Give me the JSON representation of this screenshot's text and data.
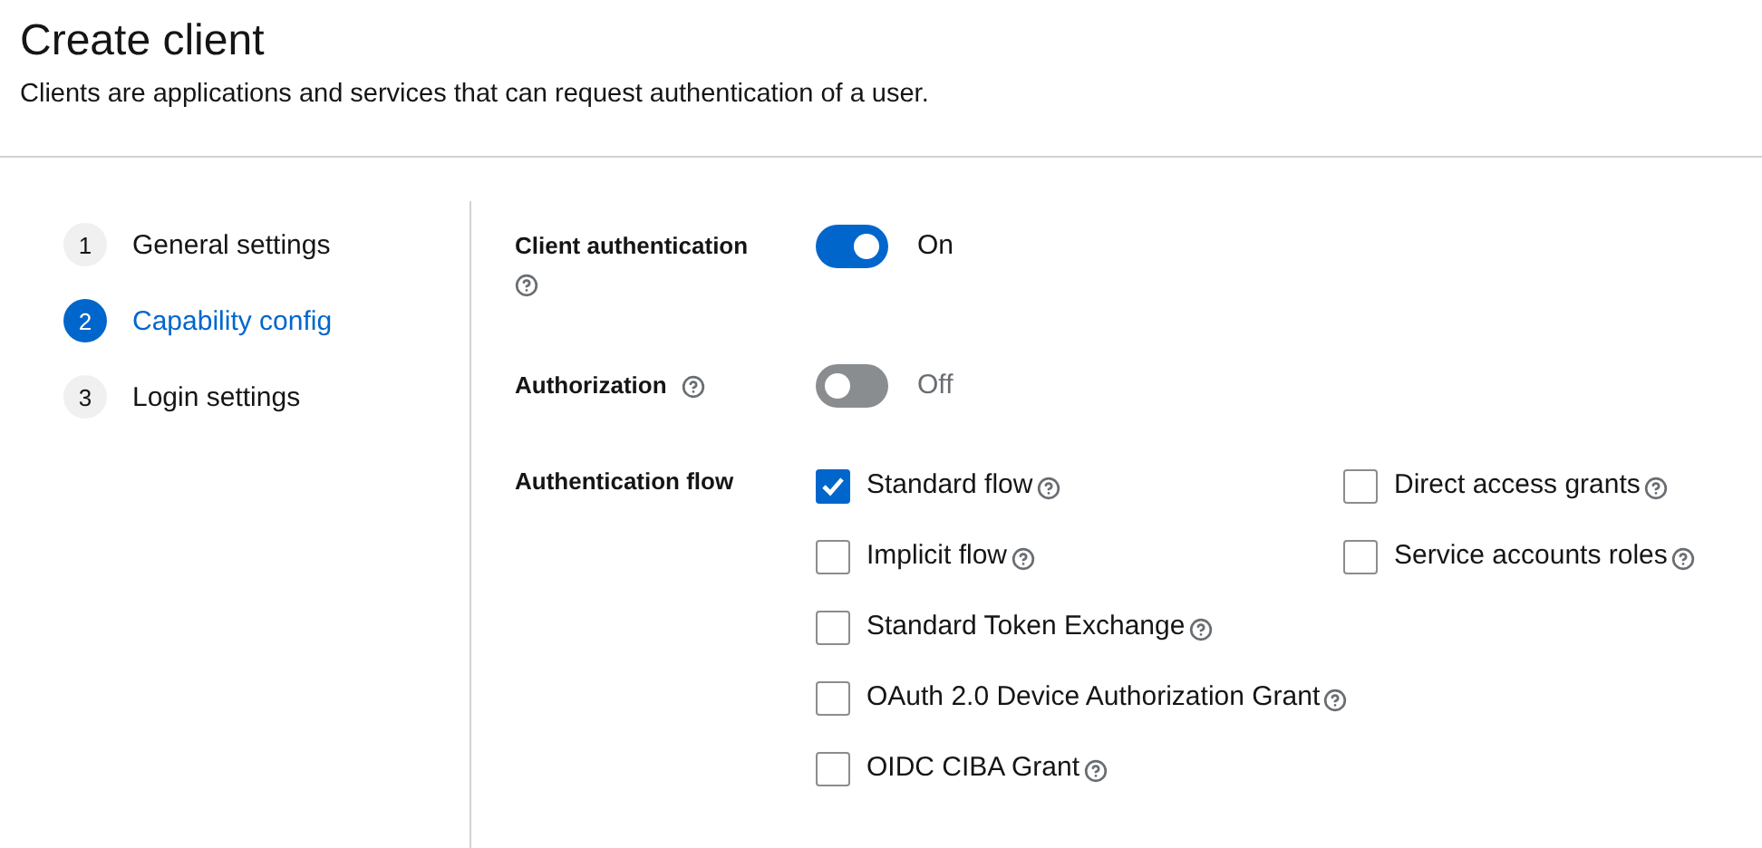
{
  "page": {
    "title": "Create client",
    "description": "Clients are applications and services that can request authentication of a user."
  },
  "steps": [
    {
      "number": "1",
      "label": "General settings",
      "selected": false
    },
    {
      "number": "2",
      "label": "Capability config",
      "selected": true
    },
    {
      "number": "3",
      "label": "Login settings",
      "selected": false
    }
  ],
  "fields": [
    {
      "kind": "switch",
      "label": "Client authentication",
      "on": true,
      "state_label": "On"
    },
    {
      "kind": "switch",
      "label": "Authorization",
      "on": false,
      "state_label": "Off"
    },
    {
      "kind": "checkboxes",
      "label": "Authentication flow",
      "options": [
        {
          "label": "Standard flow",
          "checked": true
        },
        {
          "label": "Direct access grants",
          "checked": false
        },
        {
          "label": "Implicit flow",
          "checked": false
        },
        {
          "label": "Service accounts roles",
          "checked": false
        },
        {
          "label": "Standard Token Exchange",
          "checked": false
        },
        {
          "label": "OAuth 2.0 Device Authorization Grant",
          "checked": false
        },
        {
          "label": "OIDC CIBA Grant",
          "checked": false
        }
      ]
    }
  ]
}
